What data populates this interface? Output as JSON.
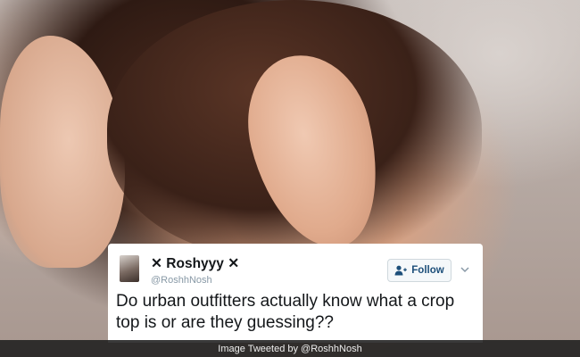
{
  "tweet": {
    "display_name": "✕ Roshyyy ✕",
    "handle": "@RoshhNosh",
    "follow_label": "Follow",
    "follow_icon": "add-user-icon",
    "menu_icon": "chevron-down-icon",
    "text": "Do urban outfitters actually know what a crop top is or are they guessing??"
  },
  "caption": {
    "text": "Image Tweeted by @RoshhNosh"
  },
  "colors": {
    "tweet_background": "#ffffff",
    "follow_text": "#1d4f7a",
    "handle_text": "#8899a6",
    "caption_bar": "#1e1e1e"
  }
}
